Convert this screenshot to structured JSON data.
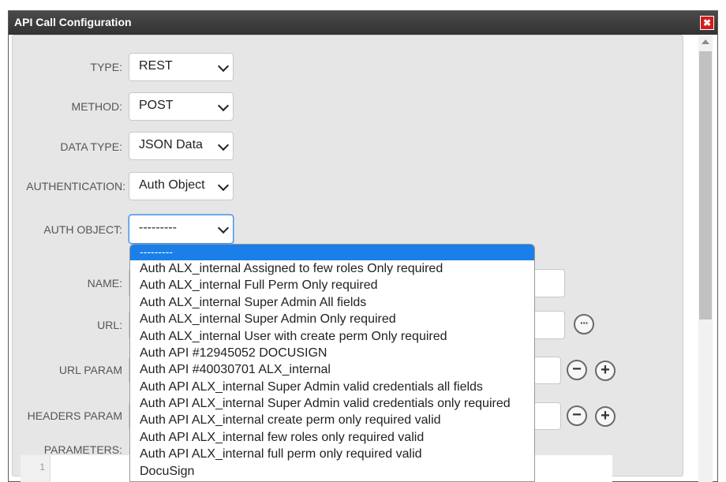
{
  "dialog": {
    "title": "API Call Configuration",
    "close_label": "✖"
  },
  "form": {
    "type": {
      "label": "TYPE:",
      "value": "REST"
    },
    "method": {
      "label": "METHOD:",
      "value": "POST"
    },
    "data_type": {
      "label": "DATA TYPE:",
      "value": "JSON Data"
    },
    "authentication": {
      "label": "AUTHENTICATION:",
      "value": "Auth Object"
    },
    "auth_object": {
      "label": "AUTH OBJECT:",
      "value": "---------"
    },
    "name": {
      "label": "NAME:"
    },
    "url": {
      "label": "URL:",
      "more_label": "···"
    },
    "url_param": {
      "label": "URL PARAM",
      "remove_label": "−",
      "add_label": "+"
    },
    "headers_param": {
      "label": "HEADERS PARAM",
      "remove_label": "−",
      "add_label": "+"
    },
    "parameters": {
      "label": "PARAMETERS:",
      "line_number": "1"
    }
  },
  "auth_object_dropdown": {
    "options": [
      "---------",
      "Auth ALX_internal Assigned to few roles Only required",
      "Auth ALX_internal Full Perm Only required",
      "Auth ALX_internal Super Admin All fields",
      "Auth ALX_internal Super Admin Only required",
      "Auth ALX_internal User with create perm Only required",
      "Auth API #12945052 DOCUSIGN",
      "Auth API #40030701 ALX_internal",
      "Auth API ALX_internal Super Admin valid credentials all fields",
      "Auth API ALX_internal Super Admin valid credentials only required",
      "Auth API ALX_internal create perm only required valid",
      "Auth API ALX_internal few roles only required valid",
      "Auth API ALX_internal full perm only required valid",
      "DocuSign"
    ],
    "selected_index": 0
  },
  "colors": {
    "titlebar": "#333333",
    "highlight": "#1a7fe8",
    "close": "#d41c1c"
  }
}
